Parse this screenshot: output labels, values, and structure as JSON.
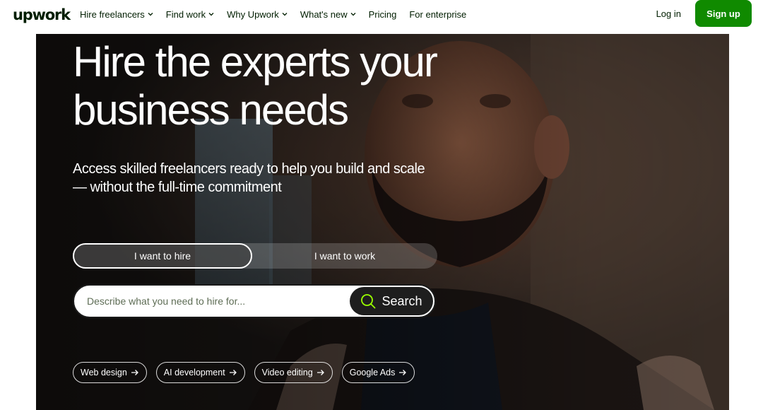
{
  "header": {
    "logo": "upwork",
    "nav": [
      {
        "label": "Hire freelancers",
        "has_dropdown": true
      },
      {
        "label": "Find work",
        "has_dropdown": true
      },
      {
        "label": "Why Upwork",
        "has_dropdown": true
      },
      {
        "label": "What's new",
        "has_dropdown": true
      },
      {
        "label": "Pricing",
        "has_dropdown": false
      },
      {
        "label": "For enterprise",
        "has_dropdown": false
      }
    ],
    "login_label": "Log in",
    "signup_label": "Sign up"
  },
  "hero": {
    "title_line1": "Hire the experts your",
    "title_line2": "business needs",
    "subtitle_line1": "Access skilled freelancers ready to help you build and scale",
    "subtitle_line2": "— without the full-time commitment",
    "toggle": {
      "hire_label": "I want to hire",
      "work_label": "I want to work",
      "selected": "hire"
    },
    "search": {
      "placeholder": "Describe what you need to hire for...",
      "value": "",
      "button_label": "Search"
    },
    "chips": [
      {
        "label": "Web design"
      },
      {
        "label": "AI development"
      },
      {
        "label": "Video editing"
      },
      {
        "label": "Google Ads"
      }
    ]
  },
  "colors": {
    "brand_green": "#108a00",
    "search_icon_accent": "#9aff00",
    "text_dark": "#001e00"
  },
  "icons": {
    "nav_dropdown": "chevron-down-icon",
    "search": "search-icon",
    "chip": "arrow-right-icon"
  }
}
